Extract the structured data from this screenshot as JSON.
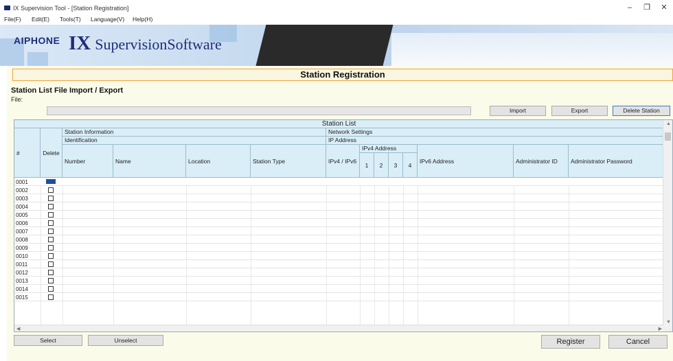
{
  "window": {
    "title": "IX Supervision Tool - [Station Registration]",
    "minimize": "–",
    "restore": "❐",
    "close": "✕"
  },
  "menu": [
    "File(F)",
    "Edit(E)",
    "Tools(T)",
    "Language(V)",
    "Help(H)"
  ],
  "banner": {
    "brand": "AIPHONE",
    "product_big": "IX",
    "product_rest": "SupervisionSoftware"
  },
  "page_title": "Station Registration",
  "import_export": {
    "heading": "Station List File Import / Export",
    "file_label": "File:",
    "file_value": "",
    "import_label": "Import",
    "export_label": "Export",
    "delete_station_label": "Delete Station"
  },
  "table": {
    "title": "Station List",
    "group_station_info": "Station Information",
    "group_identification": "Identification",
    "group_network": "Network Settings",
    "group_ip_address": "IP Address",
    "group_ipv4": "IPv4 Address",
    "col_num": "#",
    "col_delete": "Delete",
    "col_number": "Number",
    "col_name": "Name",
    "col_location": "Location",
    "col_station_type": "Station Type",
    "col_ipv4_ipv6": "IPv4 / IPv6",
    "col_oct1": "1",
    "col_oct2": "2",
    "col_oct3": "3",
    "col_oct4": "4",
    "col_ipv6": "IPv6 Address",
    "col_admin_id": "Administrator ID",
    "col_admin_pw": "Administrator Password",
    "rows": [
      "0001",
      "0002",
      "0003",
      "0004",
      "0005",
      "0006",
      "0007",
      "0008",
      "0009",
      "0010",
      "0011",
      "0012",
      "0013",
      "0014",
      "0015"
    ]
  },
  "footer": {
    "select_label": "Select",
    "unselect_label": "Unselect",
    "register_label": "Register",
    "cancel_label": "Cancel"
  },
  "colors": {
    "accent_border": "#f0a040",
    "header_bg": "#daeef7",
    "brand_blue": "#1d2d7a"
  }
}
